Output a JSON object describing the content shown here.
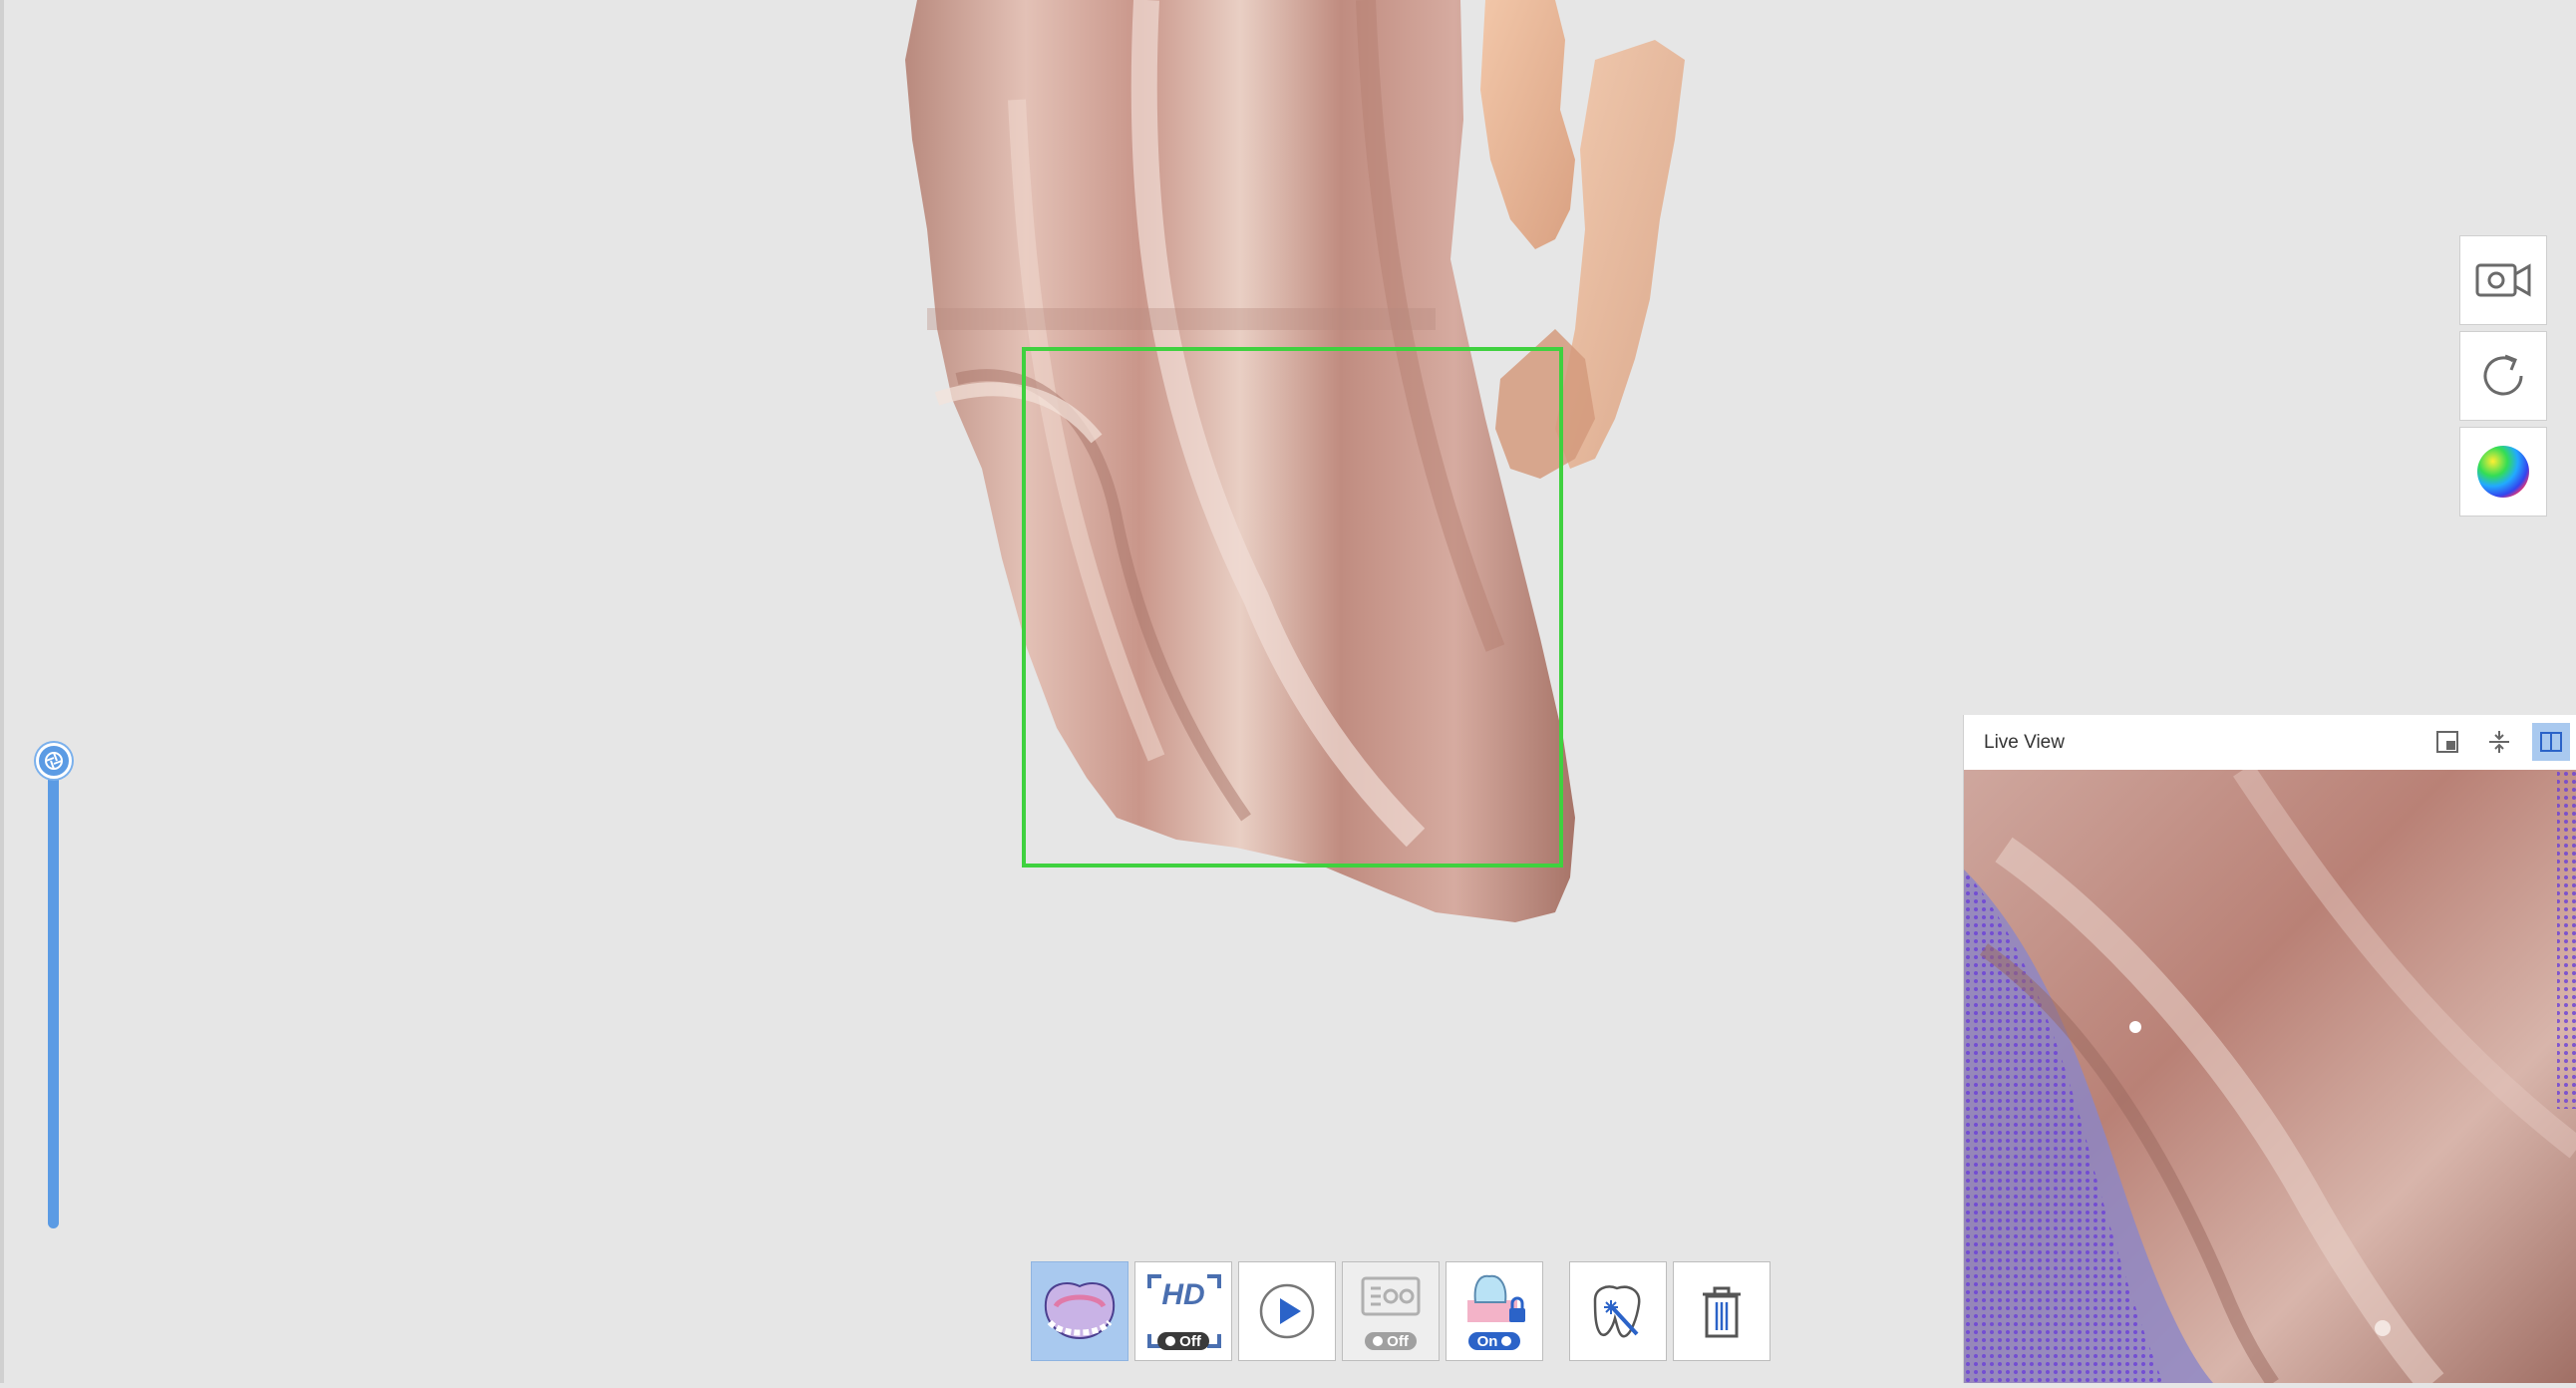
{
  "app": {
    "accent_color": "#5b9be4",
    "scan_box_color": "#3fd13f"
  },
  "slider": {
    "icon": "aperture-icon"
  },
  "side_tools": [
    {
      "name": "video-camera-icon"
    },
    {
      "name": "refresh-icon"
    },
    {
      "name": "color-map-icon"
    }
  ],
  "toolbar": {
    "buttons": [
      {
        "name": "arch-scan-button",
        "icon": "dental-arch-icon",
        "active": true
      },
      {
        "name": "hd-toggle-button",
        "label": "HD",
        "toggle": "Off"
      },
      {
        "name": "play-button",
        "icon": "play-icon"
      },
      {
        "name": "filter-toggle-button",
        "icon": "scanner-filter-icon",
        "toggle": "Off",
        "disabled": true
      },
      {
        "name": "lock-toggle-button",
        "icon": "tooth-lock-icon",
        "toggle": "On"
      },
      {
        "name": "smart-trim-button",
        "icon": "magic-wand-tooth-icon"
      },
      {
        "name": "delete-button",
        "icon": "trash-icon"
      }
    ]
  },
  "live_view": {
    "title": "Live View",
    "header_icons": [
      "layout-icon",
      "fit-icon",
      "split-view-icon"
    ]
  }
}
